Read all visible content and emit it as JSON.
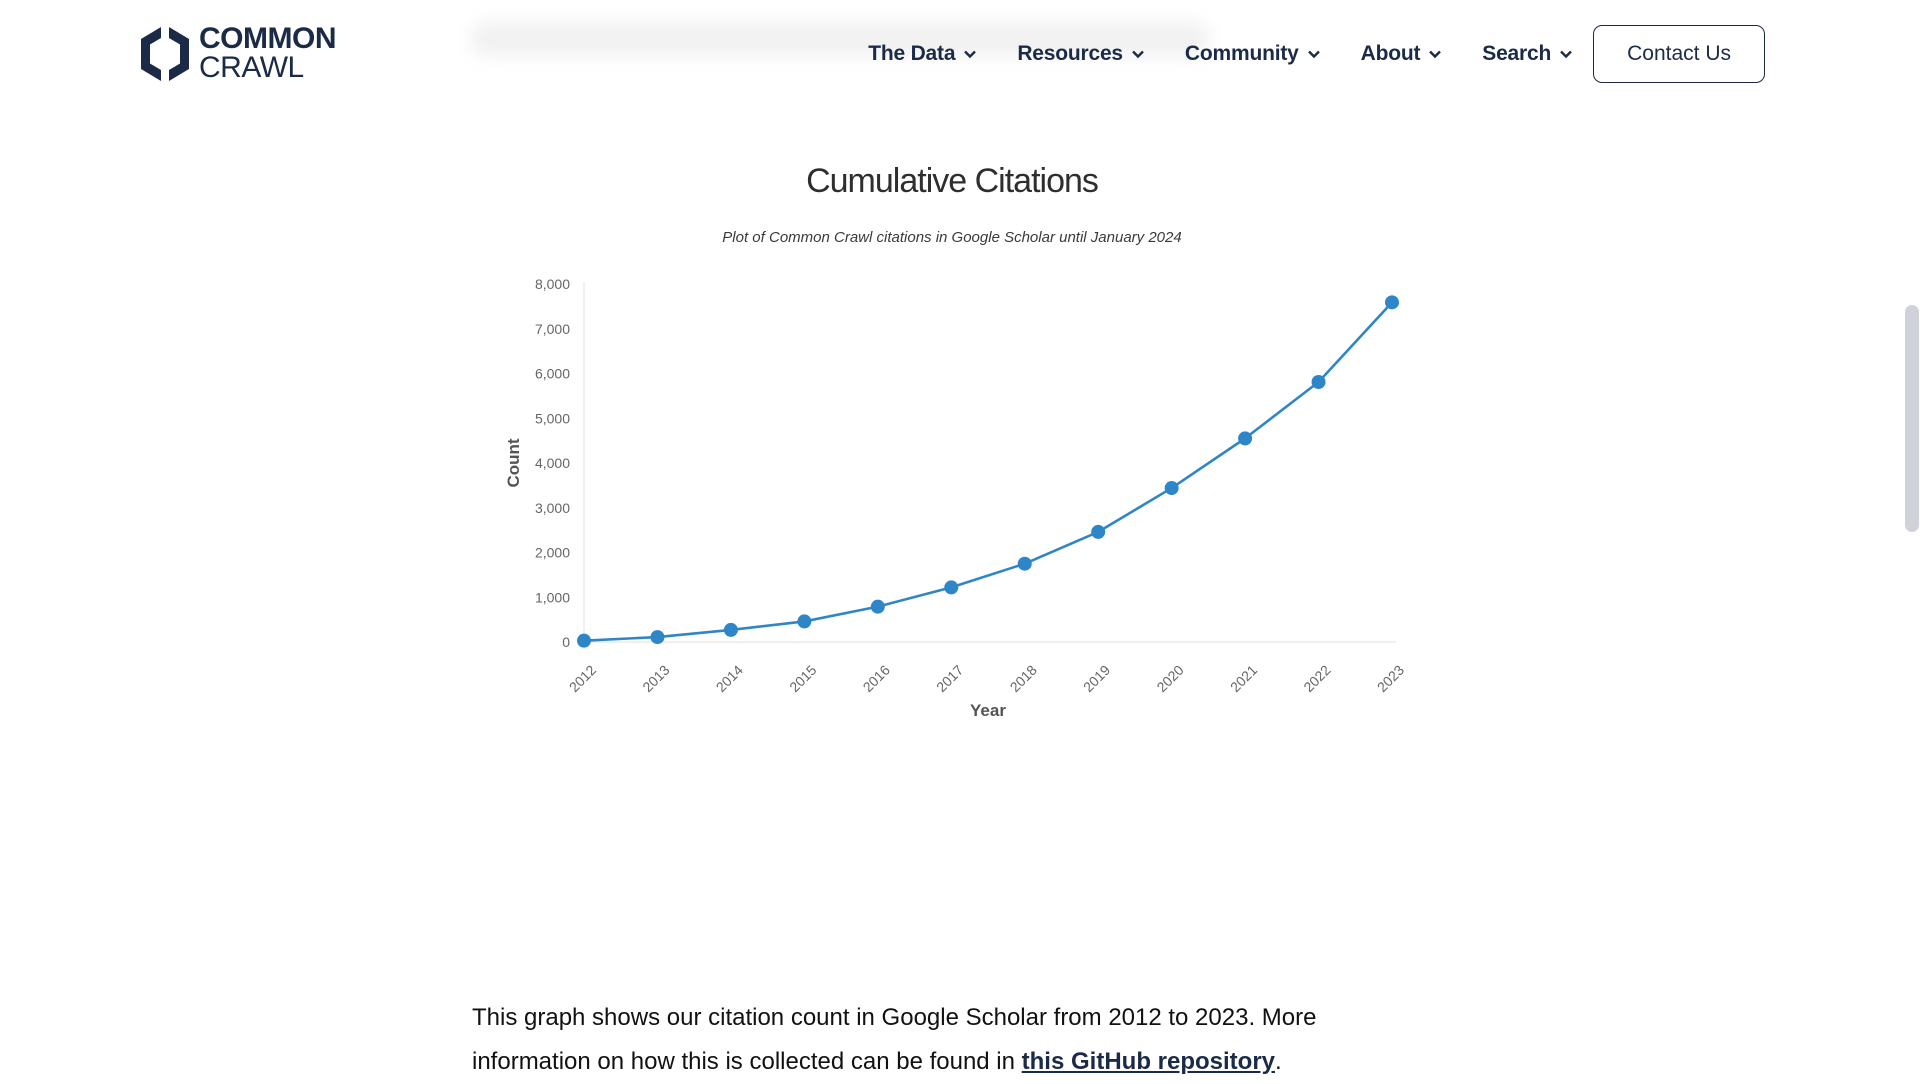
{
  "header": {
    "logo": {
      "line1": "COMMON",
      "line2": "CRAWL",
      "icon": "hexagon-logo-icon"
    },
    "nav": [
      {
        "label": "The Data",
        "icon": "chevron-down-icon"
      },
      {
        "label": "Resources",
        "icon": "chevron-down-icon"
      },
      {
        "label": "Community",
        "icon": "chevron-down-icon"
      },
      {
        "label": "About",
        "icon": "chevron-down-icon"
      },
      {
        "label": "Search",
        "icon": "chevron-down-icon"
      }
    ],
    "contact_label": "Contact Us"
  },
  "colors": {
    "brand": "#1b2b47",
    "series": "#2e86c8",
    "axis": "#dddddd",
    "tick_text": "#666666"
  },
  "chart_data": {
    "type": "line",
    "title": "Cumulative Citations",
    "subtitle": "Plot of Common Crawl citations in Google Scholar until January 2024",
    "xlabel": "Year",
    "ylabel": "Count",
    "x": [
      "2012",
      "2013",
      "2014",
      "2015",
      "2016",
      "2017",
      "2018",
      "2019",
      "2020",
      "2021",
      "2022",
      "2023"
    ],
    "series": [
      {
        "name": "Cumulative citations",
        "values": [
          30,
          110,
          270,
          460,
          790,
          1220,
          1750,
          2460,
          3440,
          4550,
          5810,
          7590
        ]
      }
    ],
    "ylim": [
      0,
      8000
    ],
    "yticks": [
      0,
      1000,
      2000,
      3000,
      4000,
      5000,
      6000,
      7000,
      8000
    ],
    "ytick_labels": [
      "0",
      "1,000",
      "2,000",
      "3,000",
      "4,000",
      "5,000",
      "6,000",
      "7,000",
      "8,000"
    ],
    "grid": false,
    "legend": "none"
  },
  "body": {
    "text_before": "This graph shows our citation count in Google Scholar from 2012 to 2023.  More information on how this is collected can be found in ",
    "link_text": "this GitHub repository",
    "text_after": "."
  }
}
